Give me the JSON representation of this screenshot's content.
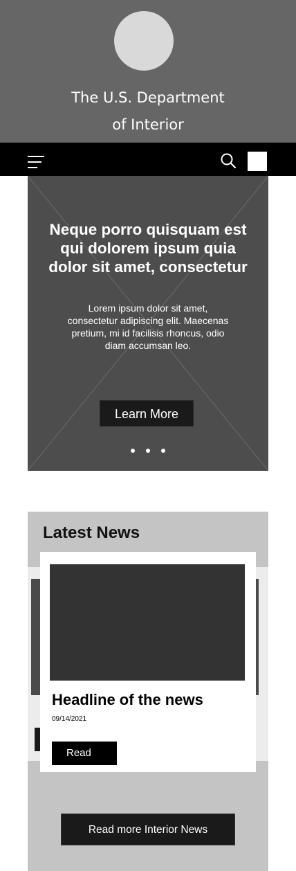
{
  "header": {
    "title_line1": "The U.S. Department",
    "title_line2": "of Interior",
    "background_color": "#666666",
    "logo_color": "#d9d9d9"
  },
  "navbar": {
    "background_color": "#000000",
    "menu_icon": "hamburger-menu-icon",
    "search_icon": "search-icon",
    "extra_icon": "square-placeholder-icon"
  },
  "hero": {
    "headline_lines": [
      "Neque porro quisquam est",
      "qui dolorem ipsum quia",
      "dolor sit amet, consectetur"
    ],
    "body_lines": [
      "Lorem ipsum dolor sit amet,",
      "consectetur adipiscing elit. Maecenas",
      "pretium, mi id facilisis rhoncus, odio",
      "diam accumsan leo."
    ],
    "button_label": "Learn More",
    "carousel_dots": 3,
    "background_color": "#4d4d4d"
  },
  "news": {
    "section_title": "Latest News",
    "card": {
      "headline": "Headline of the news",
      "date": "09/14/2021",
      "button_label": "Read"
    },
    "read_more_label": "Read more Interior News",
    "background_color": "#c4c4c4"
  }
}
